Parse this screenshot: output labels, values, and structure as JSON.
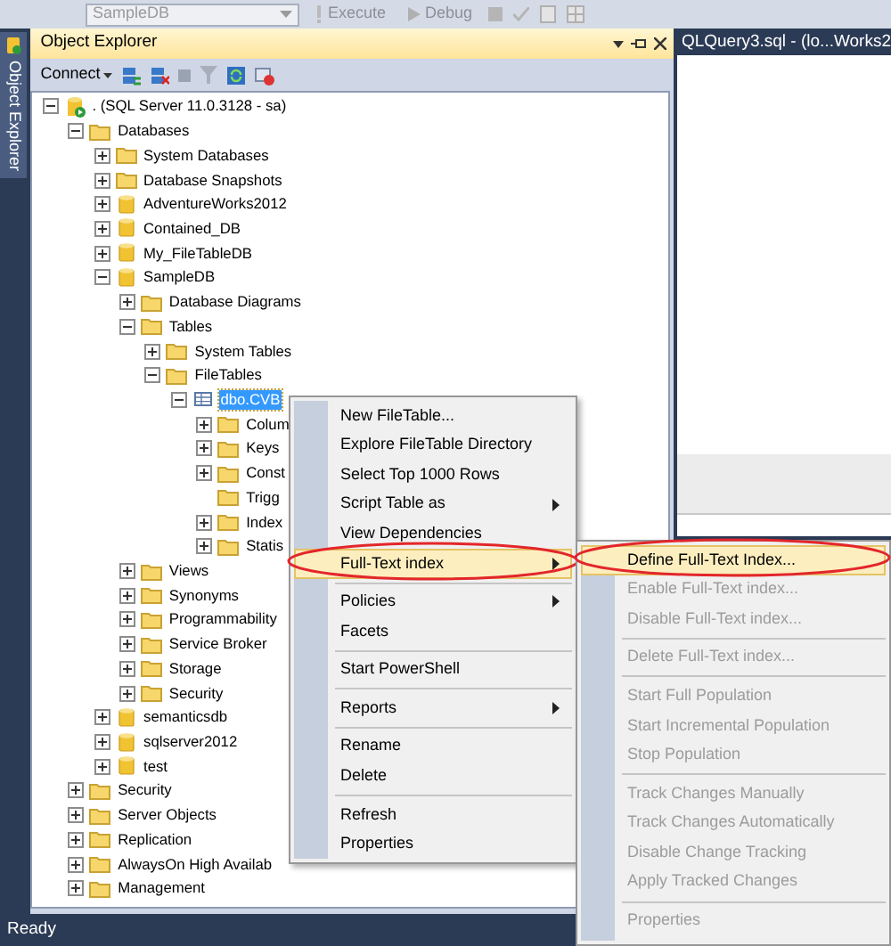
{
  "toolbar": {
    "database": "SampleDB",
    "buttons": [
      "Execute",
      "Debug"
    ]
  },
  "side_tab": {
    "label": "Object Explorer"
  },
  "object_explorer": {
    "title": "Object Explorer",
    "connect": "Connect",
    "tree": [
      {
        "label": ". (SQL Server 11.0.3128 - sa)",
        "kind": "server",
        "expanded": true,
        "selected": false,
        "children": [
          {
            "label": "Databases",
            "kind": "folder",
            "expanded": true,
            "selected": false,
            "children": [
              {
                "label": "System Databases",
                "kind": "folder",
                "expanded": false,
                "selected": false
              },
              {
                "label": "Database Snapshots",
                "kind": "folder",
                "expanded": false,
                "selected": false
              },
              {
                "label": "AdventureWorks2012",
                "kind": "database",
                "expanded": false,
                "selected": false
              },
              {
                "label": "Contained_DB",
                "kind": "database",
                "expanded": false,
                "selected": false
              },
              {
                "label": "My_FileTableDB",
                "kind": "database",
                "expanded": false,
                "selected": false
              },
              {
                "label": "SampleDB",
                "kind": "database",
                "expanded": true,
                "selected": false,
                "children": [
                  {
                    "label": "Database Diagrams",
                    "kind": "folder",
                    "expanded": false,
                    "selected": false
                  },
                  {
                    "label": "Tables",
                    "kind": "folder",
                    "expanded": true,
                    "selected": false,
                    "children": [
                      {
                        "label": "System Tables",
                        "kind": "folder",
                        "expanded": false,
                        "selected": false
                      },
                      {
                        "label": "FileTables",
                        "kind": "folder",
                        "expanded": true,
                        "selected": false,
                        "children": [
                          {
                            "label": "dbo.CVB",
                            "kind": "table",
                            "expanded": true,
                            "selected": true,
                            "children": [
                              {
                                "label": "Colum",
                                "kind": "folder",
                                "expanded": false,
                                "selected": false
                              },
                              {
                                "label": "Keys",
                                "kind": "folder",
                                "expanded": false,
                                "selected": false
                              },
                              {
                                "label": "Const",
                                "kind": "folder",
                                "expanded": false,
                                "selected": false
                              },
                              {
                                "label": "Trigg",
                                "kind": "folder",
                                "selected": false
                              },
                              {
                                "label": "Index",
                                "kind": "folder",
                                "expanded": false,
                                "selected": false
                              },
                              {
                                "label": "Statis",
                                "kind": "folder",
                                "expanded": false,
                                "selected": false
                              }
                            ]
                          }
                        ]
                      }
                    ]
                  },
                  {
                    "label": "Views",
                    "kind": "folder",
                    "expanded": false,
                    "selected": false
                  },
                  {
                    "label": "Synonyms",
                    "kind": "folder",
                    "expanded": false,
                    "selected": false
                  },
                  {
                    "label": "Programmability",
                    "kind": "folder",
                    "expanded": false,
                    "selected": false
                  },
                  {
                    "label": "Service Broker",
                    "kind": "folder",
                    "expanded": false,
                    "selected": false
                  },
                  {
                    "label": "Storage",
                    "kind": "folder",
                    "expanded": false,
                    "selected": false
                  },
                  {
                    "label": "Security",
                    "kind": "folder",
                    "expanded": false,
                    "selected": false
                  }
                ]
              },
              {
                "label": "semanticsdb",
                "kind": "database",
                "expanded": false,
                "selected": false
              },
              {
                "label": "sqlserver2012",
                "kind": "database",
                "expanded": false,
                "selected": false
              },
              {
                "label": "test",
                "kind": "database",
                "expanded": false,
                "selected": false
              }
            ]
          },
          {
            "label": "Security",
            "kind": "folder",
            "expanded": false,
            "selected": false
          },
          {
            "label": "Server Objects",
            "kind": "folder",
            "expanded": false,
            "selected": false
          },
          {
            "label": "Replication",
            "kind": "folder",
            "expanded": false,
            "selected": false
          },
          {
            "label": "AlwaysOn High Availab",
            "kind": "folder",
            "expanded": false,
            "selected": false
          },
          {
            "label": "Management",
            "kind": "folder",
            "expanded": false,
            "selected": false
          }
        ]
      }
    ]
  },
  "editor_tab": {
    "title": "QLQuery3.sql - (lo...Works2"
  },
  "context_menu": {
    "groups": [
      [
        {
          "label": "New FileTable...",
          "has_submenu": false,
          "selected": false
        },
        {
          "label": "Explore FileTable Directory",
          "has_submenu": false,
          "selected": false
        },
        {
          "label": "Select Top 1000 Rows",
          "has_submenu": false,
          "selected": false
        },
        {
          "label": "Script Table as",
          "has_submenu": true,
          "selected": false
        },
        {
          "label": "View Dependencies",
          "has_submenu": false,
          "selected": false
        },
        {
          "label": "Full-Text index",
          "has_submenu": true,
          "selected": true
        }
      ],
      [
        {
          "label": "Policies",
          "has_submenu": true,
          "selected": false
        },
        {
          "label": "Facets",
          "has_submenu": false,
          "selected": false
        }
      ],
      [
        {
          "label": "Start PowerShell",
          "has_submenu": false,
          "selected": false
        }
      ],
      [
        {
          "label": "Reports",
          "has_submenu": true,
          "selected": false
        }
      ],
      [
        {
          "label": "Rename",
          "has_submenu": false,
          "selected": false
        },
        {
          "label": "Delete",
          "has_submenu": false,
          "selected": false
        }
      ],
      [
        {
          "label": "Refresh",
          "has_submenu": false,
          "selected": false
        },
        {
          "label": "Properties",
          "has_submenu": false,
          "selected": false
        }
      ]
    ]
  },
  "submenu": {
    "groups": [
      [
        {
          "label": "Define Full-Text Index...",
          "disabled": false,
          "selected": true
        },
        {
          "label": "Enable Full-Text index...",
          "disabled": true,
          "selected": false
        },
        {
          "label": "Disable Full-Text index...",
          "disabled": true,
          "selected": false
        }
      ],
      [
        {
          "label": "Delete Full-Text index...",
          "disabled": true,
          "selected": false
        }
      ],
      [
        {
          "label": "Start Full Population",
          "disabled": true,
          "selected": false
        },
        {
          "label": "Start Incremental Population",
          "disabled": true,
          "selected": false
        },
        {
          "label": "Stop Population",
          "disabled": true,
          "selected": false
        }
      ],
      [
        {
          "label": "Track Changes Manually",
          "disabled": true,
          "selected": false
        },
        {
          "label": "Track Changes Automatically",
          "disabled": true,
          "selected": false
        },
        {
          "label": "Disable Change Tracking",
          "disabled": true,
          "selected": false
        },
        {
          "label": "Apply Tracked Changes",
          "disabled": true,
          "selected": false
        }
      ],
      [
        {
          "label": "Properties",
          "disabled": true,
          "selected": false
        }
      ]
    ]
  },
  "status_bar": {
    "text": "Ready"
  }
}
